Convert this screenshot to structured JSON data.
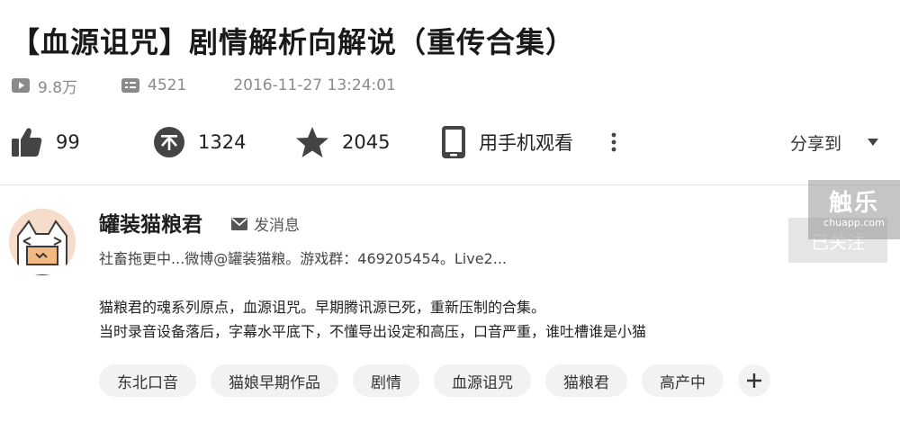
{
  "video": {
    "title": "【血源诅咒】剧情解析向解说（重传合集）",
    "views": "9.8万",
    "danmaku": "4521",
    "publish_time": "2016-11-27 13:24:01"
  },
  "actions": {
    "like_count": "99",
    "coin_count": "1324",
    "favorite_count": "2045",
    "mobile_label": "用手机观看",
    "share_label": "分享到"
  },
  "uploader": {
    "name": "罐装猫粮君",
    "message_label": "发消息",
    "signature": "社畜拖更中...微博@罐装猫粮。游戏群：469205454。Live2...",
    "follow_label": "已关注"
  },
  "description": {
    "line1": "猫粮君的魂系列原点，血源诅咒。早期腾讯源已死，重新压制的合集。",
    "line2": "当时录音设备落后，字幕水平底下，不懂导出设定和高压，口音严重，谁吐槽谁是小猫"
  },
  "tags": [
    "东北口音",
    "猫娘早期作品",
    "剧情",
    "血源诅咒",
    "猫粮君",
    "高产中"
  ],
  "watermark": {
    "main": "触乐",
    "sub": "chuapp.com"
  },
  "icons": {
    "views": "play-icon",
    "danmaku": "danmaku-icon",
    "like": "thumbs-up-icon",
    "coin": "coin-icon",
    "favorite": "star-icon",
    "mobile": "phone-icon",
    "more": "more-vertical-icon",
    "share": "chevron-down-icon",
    "message": "envelope-icon",
    "add_tag": "plus-icon"
  },
  "colors": {
    "icon_dark": "#444444",
    "meta_gray": "#8a8a8a",
    "tag_bg": "#f2f2f2",
    "follow_bg": "#e5e5e5"
  }
}
